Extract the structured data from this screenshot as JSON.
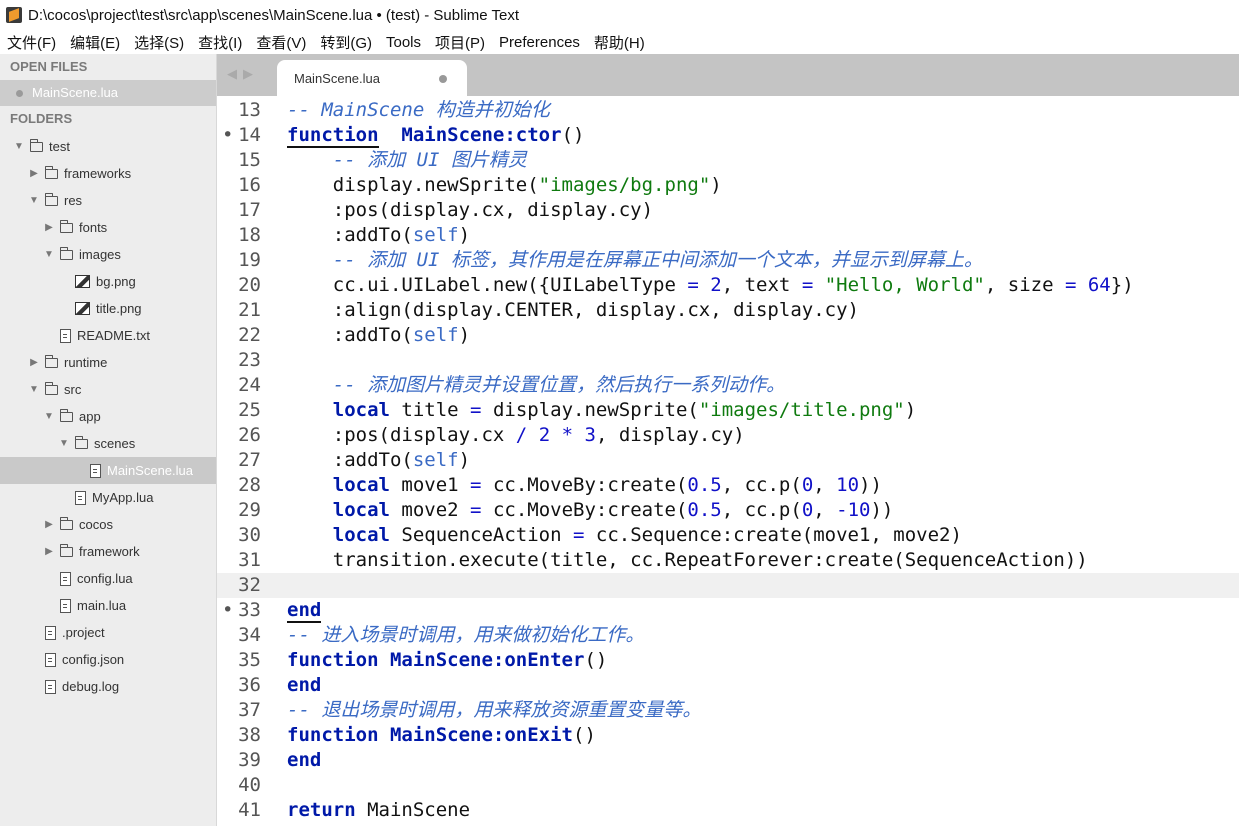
{
  "window": {
    "title": "D:\\cocos\\project\\test\\src\\app\\scenes\\MainScene.lua • (test) - Sublime Text"
  },
  "menu": [
    "文件(F)",
    "编辑(E)",
    "选择(S)",
    "查找(I)",
    "查看(V)",
    "转到(G)",
    "Tools",
    "项目(P)",
    "Preferences",
    "帮助(H)"
  ],
  "sidebar": {
    "open_files_header": "OPEN FILES",
    "open_file": "MainScene.lua",
    "folders_header": "FOLDERS",
    "tree": [
      {
        "name": "test",
        "type": "folder",
        "depth": 0,
        "expanded": true
      },
      {
        "name": "frameworks",
        "type": "folder",
        "depth": 1,
        "expanded": false
      },
      {
        "name": "res",
        "type": "folder",
        "depth": 1,
        "expanded": true
      },
      {
        "name": "fonts",
        "type": "folder",
        "depth": 2,
        "expanded": false
      },
      {
        "name": "images",
        "type": "folder",
        "depth": 2,
        "expanded": true
      },
      {
        "name": "bg.png",
        "type": "image",
        "depth": 3
      },
      {
        "name": "title.png",
        "type": "image",
        "depth": 3
      },
      {
        "name": "README.txt",
        "type": "file",
        "depth": 2
      },
      {
        "name": "runtime",
        "type": "folder",
        "depth": 1,
        "expanded": false
      },
      {
        "name": "src",
        "type": "folder",
        "depth": 1,
        "expanded": true
      },
      {
        "name": "app",
        "type": "folder",
        "depth": 2,
        "expanded": true
      },
      {
        "name": "scenes",
        "type": "folder",
        "depth": 3,
        "expanded": true
      },
      {
        "name": "MainScene.lua",
        "type": "file",
        "depth": 4,
        "selected": true
      },
      {
        "name": "MyApp.lua",
        "type": "file",
        "depth": 3
      },
      {
        "name": "cocos",
        "type": "folder",
        "depth": 2,
        "expanded": false
      },
      {
        "name": "framework",
        "type": "folder",
        "depth": 2,
        "expanded": false
      },
      {
        "name": "config.lua",
        "type": "file",
        "depth": 2
      },
      {
        "name": "main.lua",
        "type": "file",
        "depth": 2
      },
      {
        "name": ".project",
        "type": "file",
        "depth": 1
      },
      {
        "name": "config.json",
        "type": "file",
        "depth": 1
      },
      {
        "name": "debug.log",
        "type": "file",
        "depth": 1
      }
    ]
  },
  "tab": {
    "label": "MainScene.lua"
  },
  "editor": {
    "current_line": 32,
    "lines": [
      {
        "n": "13",
        "marker": "",
        "tokens": [
          [
            "cmt",
            "-- MainScene 构造并初始化"
          ]
        ]
      },
      {
        "n": "14",
        "marker": "•",
        "tokens": [
          [
            "kw under",
            "function"
          ],
          [
            "",
            "  "
          ],
          [
            "fn",
            "MainScene:ctor"
          ],
          [
            "",
            "()"
          ]
        ]
      },
      {
        "n": "15",
        "marker": "",
        "tokens": [
          [
            "",
            "    "
          ],
          [
            "cmt",
            "-- 添加 UI 图片精灵"
          ]
        ]
      },
      {
        "n": "16",
        "marker": "",
        "tokens": [
          [
            "",
            "    display.newSprite("
          ],
          [
            "str",
            "\"images/bg.png\""
          ],
          [
            "",
            ")"
          ]
        ]
      },
      {
        "n": "17",
        "marker": "",
        "tokens": [
          [
            "",
            "    :pos(display.cx, display.cy)"
          ]
        ]
      },
      {
        "n": "18",
        "marker": "",
        "tokens": [
          [
            "",
            "    :addTo("
          ],
          [
            "self",
            "self"
          ],
          [
            "",
            ")"
          ]
        ]
      },
      {
        "n": "19",
        "marker": "",
        "tokens": [
          [
            "",
            "    "
          ],
          [
            "cmt",
            "-- 添加 UI 标签，其作用是在屏幕正中间添加一个文本，并显示到屏幕上。"
          ]
        ]
      },
      {
        "n": "20",
        "marker": "",
        "tokens": [
          [
            "",
            "    cc.ui.UILabel.new({UILabelType "
          ],
          [
            "op",
            "="
          ],
          [
            "",
            " "
          ],
          [
            "num-c",
            "2"
          ],
          [
            "",
            ", text "
          ],
          [
            "op",
            "="
          ],
          [
            "",
            " "
          ],
          [
            "str",
            "\"Hello, World\""
          ],
          [
            "",
            ", size "
          ],
          [
            "op",
            "="
          ],
          [
            "",
            " "
          ],
          [
            "num-c",
            "64"
          ],
          [
            "",
            "})"
          ]
        ]
      },
      {
        "n": "21",
        "marker": "",
        "tokens": [
          [
            "",
            "    :align(display.CENTER, display.cx, display.cy)"
          ]
        ]
      },
      {
        "n": "22",
        "marker": "",
        "tokens": [
          [
            "",
            "    :addTo("
          ],
          [
            "self",
            "self"
          ],
          [
            "",
            ")"
          ]
        ]
      },
      {
        "n": "23",
        "marker": "",
        "tokens": []
      },
      {
        "n": "24",
        "marker": "",
        "tokens": [
          [
            "",
            "    "
          ],
          [
            "cmt",
            "-- 添加图片精灵并设置位置，然后执行一系列动作。"
          ]
        ]
      },
      {
        "n": "25",
        "marker": "",
        "tokens": [
          [
            "",
            "    "
          ],
          [
            "kw",
            "local"
          ],
          [
            "",
            " title "
          ],
          [
            "op",
            "="
          ],
          [
            "",
            " display.newSprite("
          ],
          [
            "str",
            "\"images/title.png\""
          ],
          [
            "",
            ")"
          ]
        ]
      },
      {
        "n": "26",
        "marker": "",
        "tokens": [
          [
            "",
            "    :pos(display.cx "
          ],
          [
            "op",
            "/"
          ],
          [
            "",
            " "
          ],
          [
            "num-c",
            "2"
          ],
          [
            "",
            " "
          ],
          [
            "op",
            "*"
          ],
          [
            "",
            " "
          ],
          [
            "num-c",
            "3"
          ],
          [
            "",
            ", display.cy)"
          ]
        ]
      },
      {
        "n": "27",
        "marker": "",
        "tokens": [
          [
            "",
            "    :addTo("
          ],
          [
            "self",
            "self"
          ],
          [
            "",
            ")"
          ]
        ]
      },
      {
        "n": "28",
        "marker": "",
        "tokens": [
          [
            "",
            "    "
          ],
          [
            "kw",
            "local"
          ],
          [
            "",
            " move1 "
          ],
          [
            "op",
            "="
          ],
          [
            "",
            " cc.MoveBy:create("
          ],
          [
            "num-c",
            "0.5"
          ],
          [
            "",
            ", cc.p("
          ],
          [
            "num-c",
            "0"
          ],
          [
            "",
            ", "
          ],
          [
            "num-c",
            "10"
          ],
          [
            "",
            "))"
          ]
        ]
      },
      {
        "n": "29",
        "marker": "",
        "tokens": [
          [
            "",
            "    "
          ],
          [
            "kw",
            "local"
          ],
          [
            "",
            " move2 "
          ],
          [
            "op",
            "="
          ],
          [
            "",
            " cc.MoveBy:create("
          ],
          [
            "num-c",
            "0.5"
          ],
          [
            "",
            ", cc.p("
          ],
          [
            "num-c",
            "0"
          ],
          [
            "",
            ", "
          ],
          [
            "num-c",
            "-10"
          ],
          [
            "",
            "))"
          ]
        ]
      },
      {
        "n": "30",
        "marker": "",
        "tokens": [
          [
            "",
            "    "
          ],
          [
            "kw",
            "local"
          ],
          [
            "",
            " SequenceAction "
          ],
          [
            "op",
            "="
          ],
          [
            "",
            " cc.Sequence:create(move1, move2)"
          ]
        ]
      },
      {
        "n": "31",
        "marker": "",
        "tokens": [
          [
            "",
            "    transition.execute(title, cc.RepeatForever:create(SequenceAction))"
          ]
        ]
      },
      {
        "n": "32",
        "marker": "",
        "tokens": []
      },
      {
        "n": "33",
        "marker": "•",
        "tokens": [
          [
            "kw under",
            "end"
          ]
        ]
      },
      {
        "n": "34",
        "marker": "",
        "tokens": [
          [
            "cmt",
            "-- 进入场景时调用，用来做初始化工作。"
          ]
        ]
      },
      {
        "n": "35",
        "marker": "",
        "tokens": [
          [
            "kw",
            "function"
          ],
          [
            "",
            " "
          ],
          [
            "fn",
            "MainScene:onEnter"
          ],
          [
            "",
            "()"
          ]
        ]
      },
      {
        "n": "36",
        "marker": "",
        "tokens": [
          [
            "kw",
            "end"
          ]
        ]
      },
      {
        "n": "37",
        "marker": "",
        "tokens": [
          [
            "cmt",
            "-- 退出场景时调用，用来释放资源重置变量等。"
          ]
        ]
      },
      {
        "n": "38",
        "marker": "",
        "tokens": [
          [
            "kw",
            "function"
          ],
          [
            "",
            " "
          ],
          [
            "fn",
            "MainScene:onExit"
          ],
          [
            "",
            "()"
          ]
        ]
      },
      {
        "n": "39",
        "marker": "",
        "tokens": [
          [
            "kw",
            "end"
          ]
        ]
      },
      {
        "n": "40",
        "marker": "",
        "tokens": []
      },
      {
        "n": "41",
        "marker": "",
        "tokens": [
          [
            "kw",
            "return"
          ],
          [
            "",
            " MainScene"
          ]
        ]
      }
    ]
  }
}
